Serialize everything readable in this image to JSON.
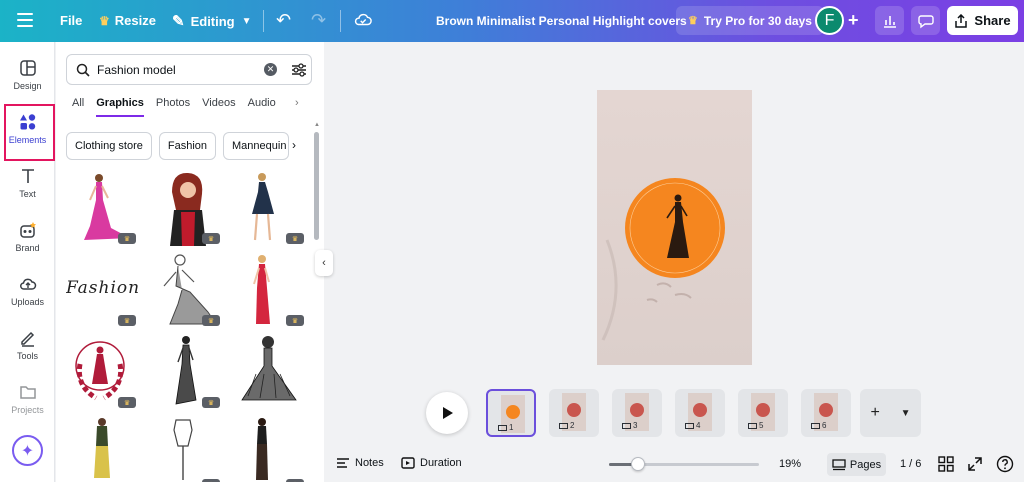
{
  "topbar": {
    "file": "File",
    "resize": "Resize",
    "editing": "Editing",
    "title": "Brown Minimalist Personal Highlight covers",
    "try_pro": "Try Pro for 30 days",
    "avatar_initial": "F",
    "share": "Share"
  },
  "rail": {
    "design": "Design",
    "elements": "Elements",
    "text": "Text",
    "brand": "Brand",
    "uploads": "Uploads",
    "tools": "Tools",
    "projects": "Projects"
  },
  "panel": {
    "search_value": "Fashion model",
    "tabs": [
      "All",
      "Graphics",
      "Photos",
      "Videos",
      "Audio"
    ],
    "active_tab": "Graphics",
    "chips": [
      "Clothing store",
      "Fashion",
      "Mannequin"
    ],
    "fashion_script": "Fashion"
  },
  "canvas": {
    "accent_color": "#f5861f",
    "page_color": "#e5dbd7"
  },
  "pages": {
    "thumbnails": [
      "1",
      "2",
      "3",
      "4",
      "5",
      "6"
    ],
    "active": 1
  },
  "bottombar": {
    "notes": "Notes",
    "duration": "Duration",
    "zoom": "19%",
    "zoom_level": 0.19,
    "pages_label": "Pages",
    "page_count": "1 / 6"
  },
  "colors": {
    "brand_purple": "#7d2ae8",
    "highlight_red": "#e3155f"
  }
}
